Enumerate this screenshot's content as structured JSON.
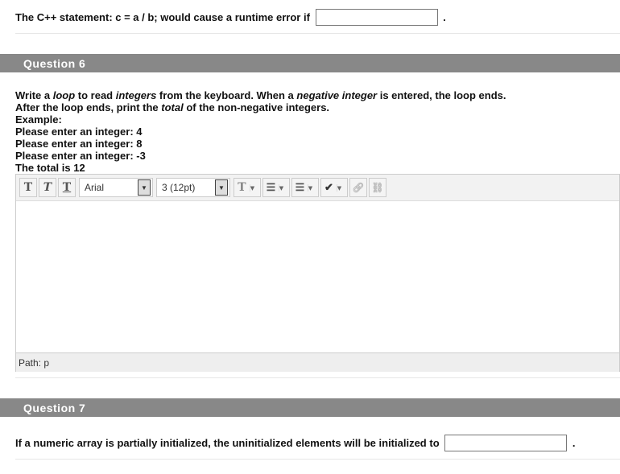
{
  "q5": {
    "text": "The C++ statement: c = a / b; would cause a runtime error if",
    "value": "",
    "suffix": "."
  },
  "q6": {
    "header": "Question 6",
    "prompt": [
      [
        {
          "t": "Write a "
        },
        {
          "t": "loop",
          "i": true
        },
        {
          "t": " to read "
        },
        {
          "t": "integers",
          "i": true
        },
        {
          "t": " from the keyboard. When a "
        },
        {
          "t": "negative integer",
          "i": true
        },
        {
          "t": " is entered, the loop ends."
        }
      ],
      [
        {
          "t": "After the loop ends, print the "
        },
        {
          "t": "total",
          "i": true
        },
        {
          "t": " of the non-negative integers."
        }
      ],
      [
        {
          "t": "Example:"
        }
      ],
      [
        {
          "t": "Please enter an integer: 4"
        }
      ],
      [
        {
          "t": "Please enter an integer: 8"
        }
      ],
      [
        {
          "t": "Please enter an integer: -3"
        }
      ],
      [
        {
          "t": "The total is 12"
        }
      ]
    ],
    "editor": {
      "font": "Arial",
      "size": "3 (12pt)",
      "path": "Path: p",
      "content": ""
    }
  },
  "q7": {
    "header": "Question 7",
    "text": "If a numeric array is partially initialized, the uninitialized elements will be initialized to",
    "value": "",
    "suffix": "."
  }
}
